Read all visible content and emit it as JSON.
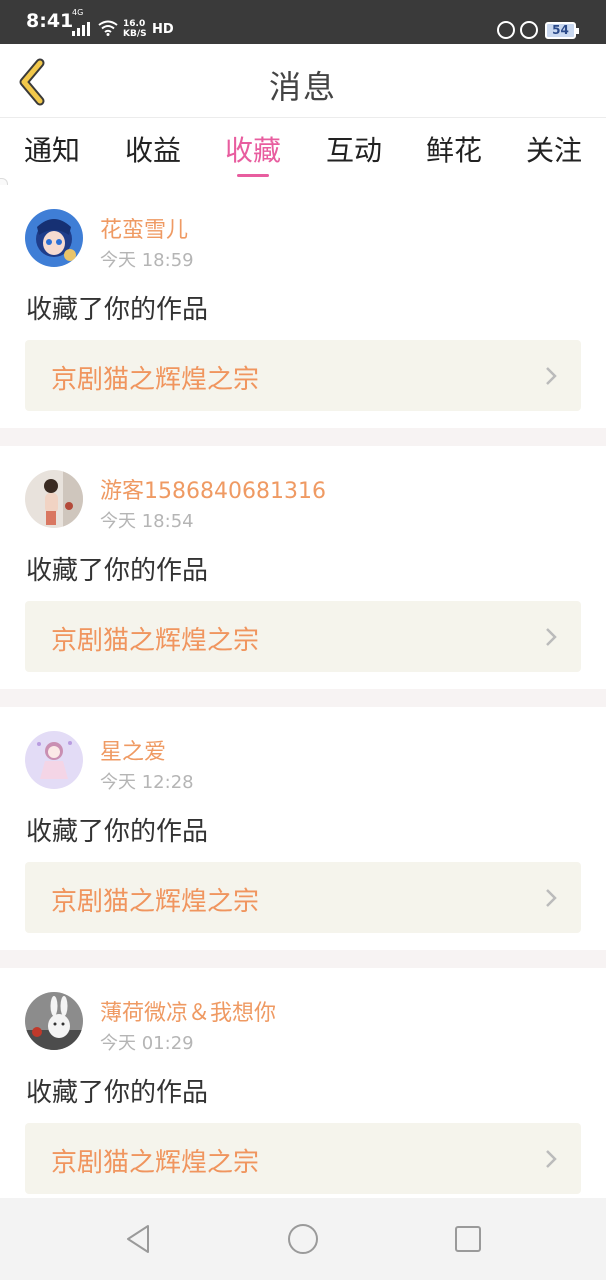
{
  "status_bar": {
    "time": "8:41",
    "network": "4G",
    "speed_value": "16.0",
    "speed_unit": "KB/S",
    "hd_label": "HD",
    "battery": "54"
  },
  "header": {
    "title": "消息",
    "back_icon": "chevron-left-icon"
  },
  "tabs": [
    {
      "label": "通知",
      "active": false
    },
    {
      "label": "收益",
      "active": false
    },
    {
      "label": "收藏",
      "active": true
    },
    {
      "label": "互动",
      "active": false
    },
    {
      "label": "鲜花",
      "active": false
    },
    {
      "label": "关注",
      "active": false
    }
  ],
  "accent_color": "#e85d9f",
  "username_color": "#ef9a63",
  "messages": [
    {
      "user": "花蛮雪儿",
      "time": "今天 18:59",
      "action": "收藏了你的作品",
      "work": "京剧猫之辉煌之宗"
    },
    {
      "user": "游客1586840681316",
      "time": "今天 18:54",
      "action": "收藏了你的作品",
      "work": "京剧猫之辉煌之宗"
    },
    {
      "user": "星之爱",
      "time": "今天 12:28",
      "action": "收藏了你的作品",
      "work": "京剧猫之辉煌之宗"
    },
    {
      "user": "薄荷微凉＆我想你",
      "time": "今天 01:29",
      "action": "收藏了你的作品",
      "work": "京剧猫之辉煌之宗"
    }
  ],
  "nav_bar": {
    "back_icon": "triangle-back-icon",
    "home_icon": "circle-home-icon",
    "recents_icon": "square-recents-icon"
  }
}
